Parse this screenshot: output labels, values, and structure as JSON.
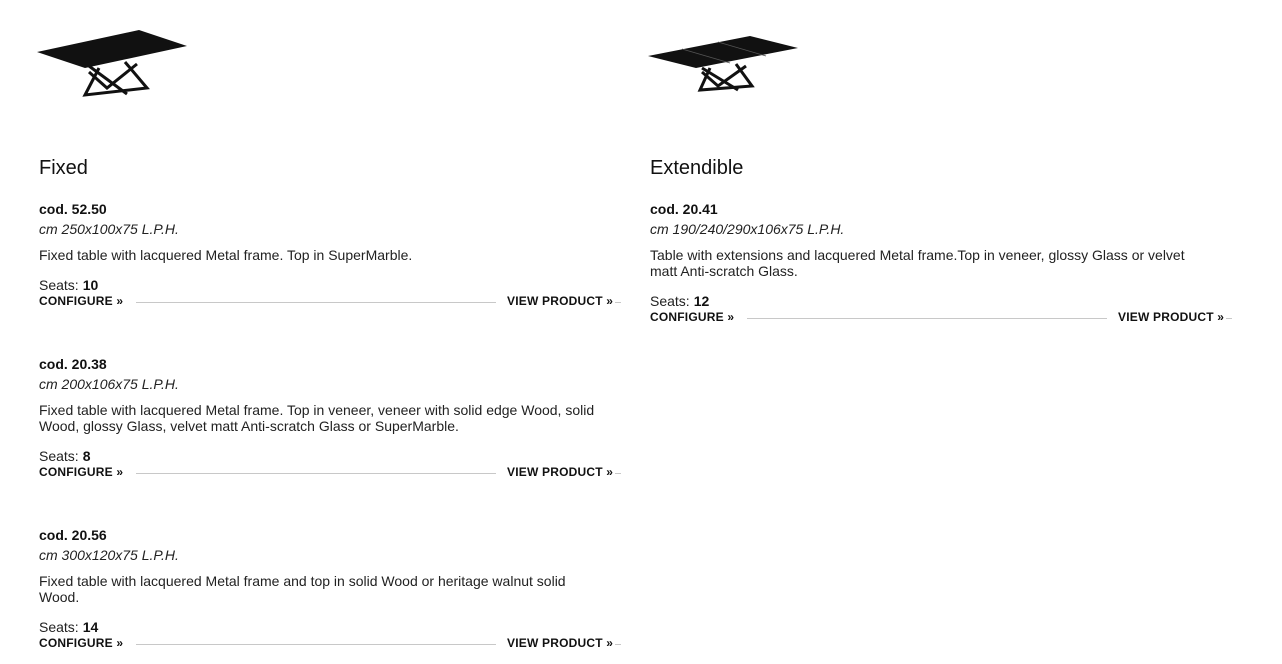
{
  "left": {
    "title": "Fixed",
    "products": [
      {
        "code": "cod. 52.50",
        "dims": "cm 250x100x75 L.P.H.",
        "desc": "Fixed table with lacquered Metal frame. Top in SuperMarble.",
        "seats_label": "Seats:",
        "seats": "10",
        "configure": "CONFIGURE »",
        "view": "VIEW PRODUCT »"
      },
      {
        "code": "cod. 20.38",
        "dims": "cm 200x106x75 L.P.H.",
        "desc": "Fixed table with lacquered Metal frame. Top in veneer, veneer with solid edge Wood, solid Wood, glossy Glass, velvet matt Anti-scratch Glass or SuperMarble.",
        "seats_label": "Seats:",
        "seats": "8",
        "configure": "CONFIGURE »",
        "view": "VIEW PRODUCT »"
      },
      {
        "code": "cod. 20.56",
        "dims": "cm 300x120x75 L.P.H.",
        "desc": "Fixed table with lacquered Metal frame and top in solid Wood or heritage walnut solid Wood.",
        "seats_label": "Seats:",
        "seats": "14",
        "configure": "CONFIGURE »",
        "view": "VIEW PRODUCT »"
      }
    ]
  },
  "right": {
    "title": "Extendible",
    "products": [
      {
        "code": "cod. 20.41",
        "dims": "cm 190/240/290x106x75 L.P.H.",
        "desc": "Table with extensions and lacquered Metal frame.Top in veneer, glossy Glass or velvet matt Anti-scratch Glass.",
        "seats_label": "Seats:",
        "seats": "12",
        "configure": "CONFIGURE »",
        "view": "VIEW PRODUCT »"
      }
    ]
  }
}
